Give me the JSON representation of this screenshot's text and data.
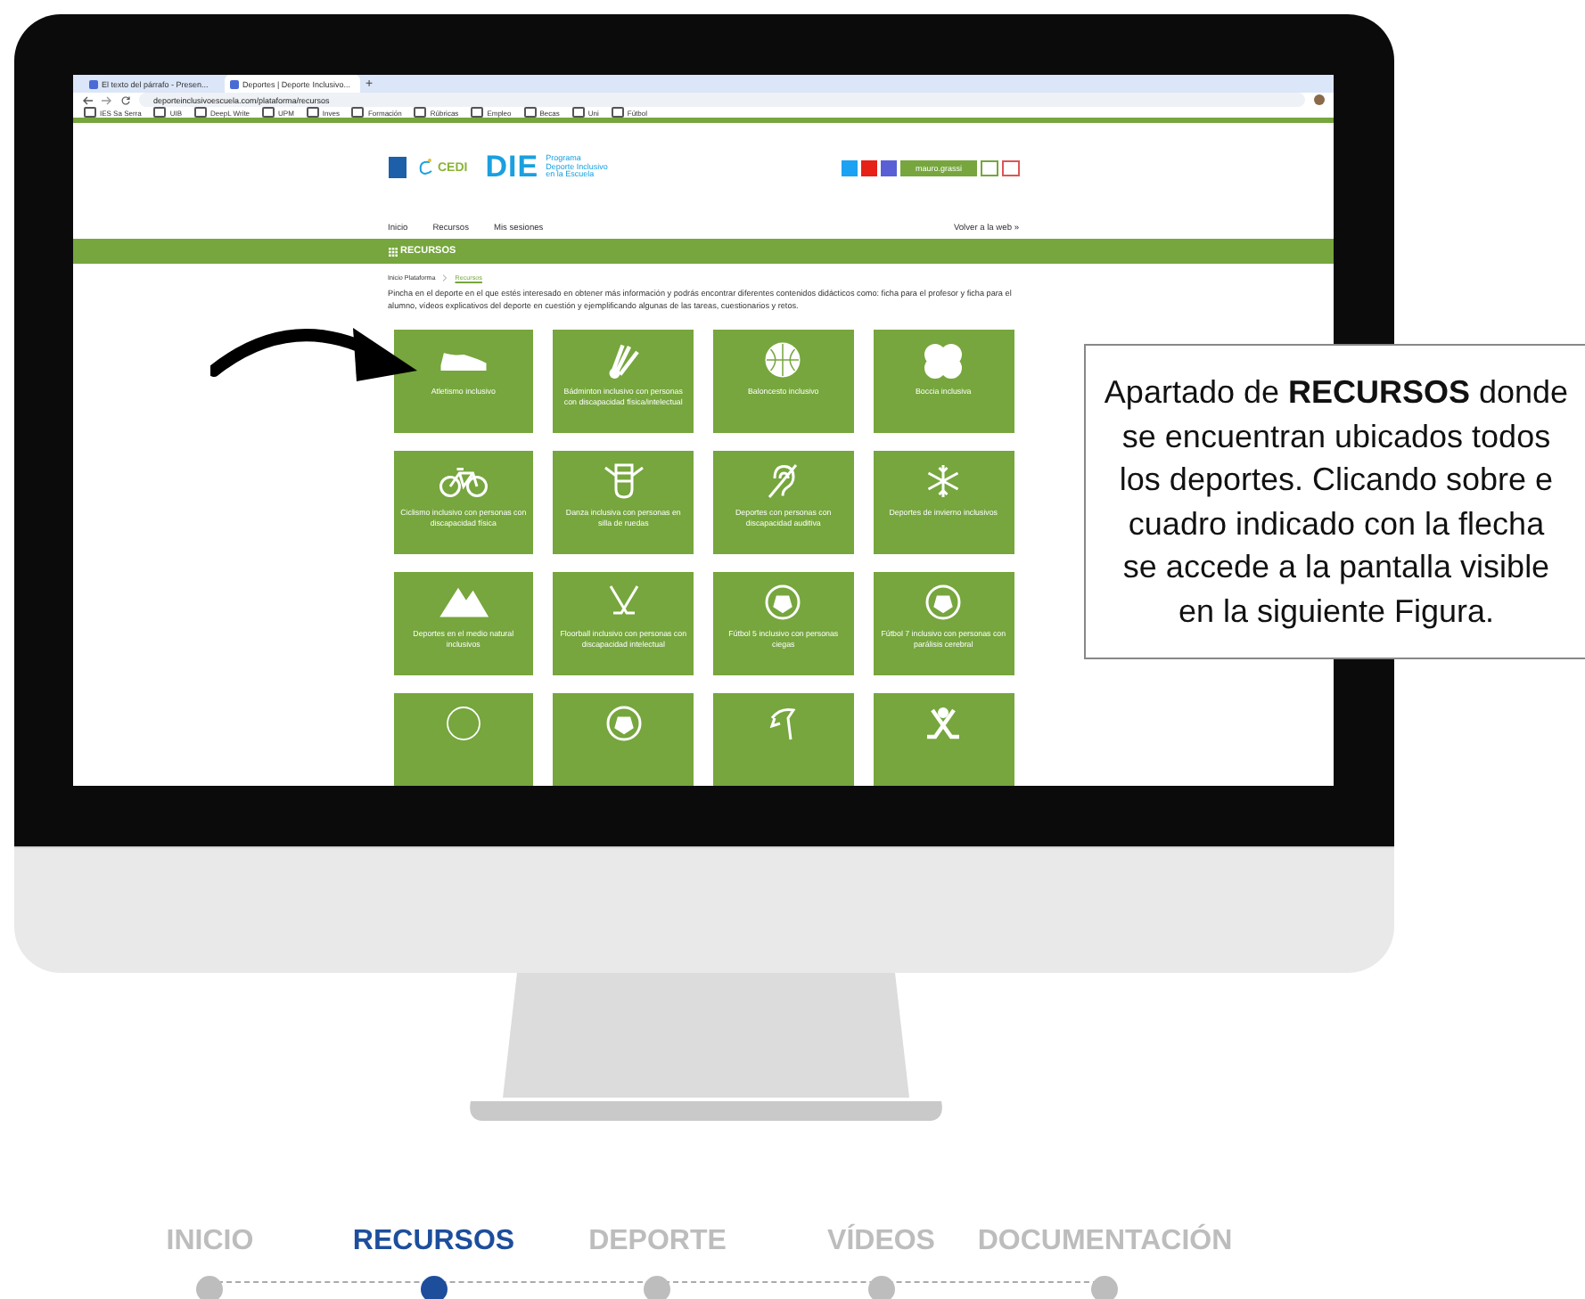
{
  "browser": {
    "tabs": [
      {
        "title": "El texto del párrafo - Presen...",
        "selected": false
      },
      {
        "title": "Deportes | Deporte Inclusivo...",
        "selected": true
      }
    ],
    "new_tab": "+",
    "url": "deporteinclusivoescuela.com/plataforma/recursos",
    "bookmarks": [
      "IES Sa Serra",
      "UIB",
      "DeepL Write",
      "UPM",
      "Inves",
      "Formación",
      "Rúbricas",
      "Empleo",
      "Becas",
      "Uni",
      "Fútbol"
    ]
  },
  "site": {
    "cedi": "CEDI",
    "die": "DIE",
    "program": "Programa\nDeporte Inclusivo\nen la Escuela",
    "user_button": "mauro.grassi",
    "nav": [
      {
        "label": "Inicio"
      },
      {
        "label": "Recursos"
      },
      {
        "label": "Mis sesiones"
      }
    ],
    "back_link": "Volver a la web »",
    "section_title": "RECURSOS",
    "breadcrumb": [
      "Inicio Plataforma",
      "Recursos"
    ],
    "intro": "Pincha en el deporte en el que estés interesado en obtener más información y podrás encontrar diferentes contenidos didácticos como: ficha para el profesor y ficha para el alumno, vídeos explicativos del deporte en cuestión y ejemplificando algunas de las tareas, cuestionarios y retos.",
    "tiles": [
      {
        "label": "Atletismo inclusivo",
        "kind": "shoe"
      },
      {
        "label": "Bádminton inclusivo con personas con discapacidad física/intelectual",
        "kind": "shuttlecock"
      },
      {
        "label": "Baloncesto inclusivo",
        "kind": "basketball"
      },
      {
        "label": "Boccia inclusiva",
        "kind": "balls"
      },
      {
        "label": "Ciclismo inclusivo con personas con discapacidad física",
        "kind": "bicycle"
      },
      {
        "label": "Danza inclusiva con personas en silla de ruedas",
        "kind": "dance"
      },
      {
        "label": "Deportes con personas con discapacidad auditiva",
        "kind": "ear"
      },
      {
        "label": "Deportes de invierno inclusivos",
        "kind": "snowflake"
      },
      {
        "label": "Deportes en el medio natural inclusivos",
        "kind": "mountains"
      },
      {
        "label": "Floorball inclusivo con personas con discapacidad intelectual",
        "kind": "sticks"
      },
      {
        "label": "Fútbol 5 inclusivo con personas ciegas",
        "kind": "soccer"
      },
      {
        "label": "Fútbol 7 inclusivo con personas con parálisis cerebral",
        "kind": "soccer"
      },
      {
        "kind": "ring"
      },
      {
        "kind": "soccer"
      },
      {
        "kind": "horse"
      },
      {
        "kind": "crossed"
      }
    ]
  },
  "callout": "Apartado de **RECURSOS** donde\nse encuentran ubicados todos\nlos deportes. Clicando sobre e\ncuadro indicado con la flecha\nse accede a la pantalla visible\nen la siguiente Figura.",
  "stepper": [
    {
      "label": "INICIO",
      "selected": false
    },
    {
      "label": "RECURSOS",
      "selected": true
    },
    {
      "label": "DEPORTE",
      "selected": false
    },
    {
      "label": "VÍDEOS",
      "selected": false
    },
    {
      "label": "DOCUMENTACIÓN",
      "selected": false
    }
  ]
}
